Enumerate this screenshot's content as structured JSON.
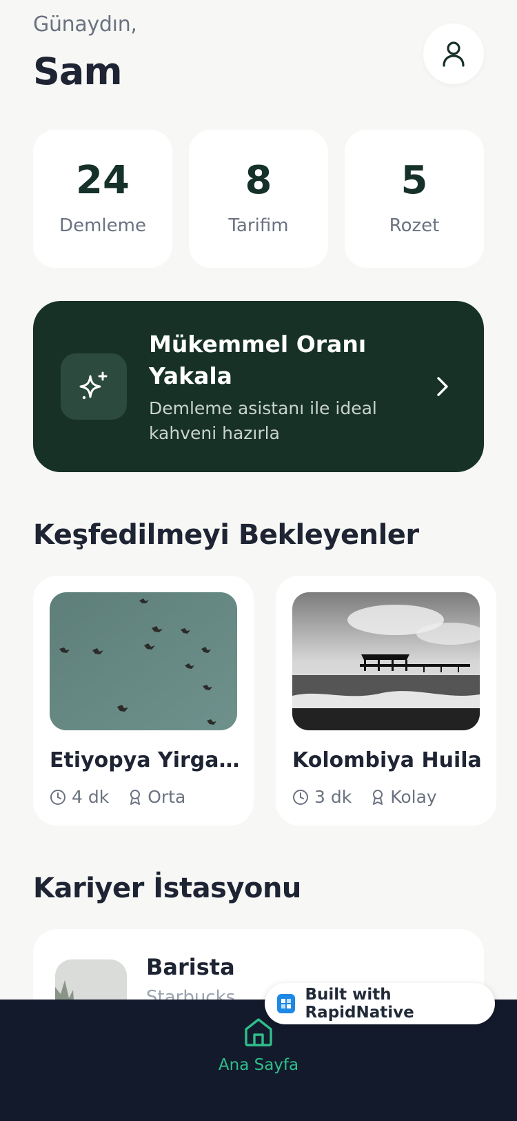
{
  "header": {
    "greeting": "Günaydın,",
    "username": "Sam"
  },
  "stats": [
    {
      "value": "24",
      "label": "Demleme"
    },
    {
      "value": "8",
      "label": "Tarifim"
    },
    {
      "value": "5",
      "label": "Rozet"
    }
  ],
  "promo": {
    "title": "Mükemmel Oranı Yakala",
    "subtitle": "Demleme asistanı ile ideal kahveni hazırla"
  },
  "discover": {
    "title": "Keşfedilmeyi Bekleyenler",
    "recipes": [
      {
        "name": "Etiyopya Yirgacheffe",
        "time": "4 dk",
        "level": "Orta"
      },
      {
        "name": "Kolombiya Huila",
        "time": "3 dk",
        "level": "Kolay"
      }
    ]
  },
  "career": {
    "title": "Kariyer İstasyonu",
    "job": {
      "title": "Barista",
      "company": "Starbucks"
    }
  },
  "tabbar": {
    "home_label": "Ana Sayfa"
  },
  "badge": {
    "text": "Built with RapidNative"
  },
  "colors": {
    "accent": "#2fbf8a",
    "promo_bg": "#173126",
    "tabbar_bg": "#131a2c"
  }
}
